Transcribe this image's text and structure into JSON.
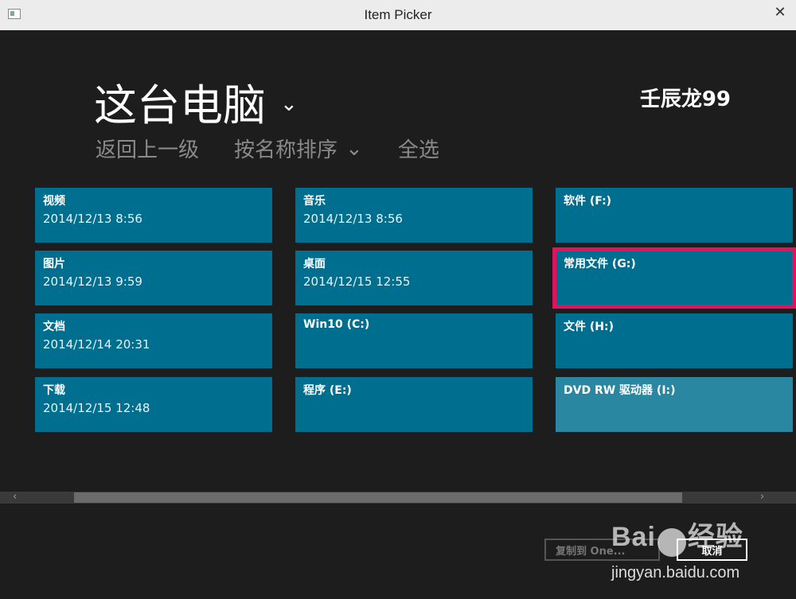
{
  "window": {
    "title": "Item Picker",
    "close": "✕"
  },
  "header": {
    "title": "这台电脑",
    "user": "壬辰龙99"
  },
  "toolbar": {
    "up": "返回上一级",
    "sort": "按名称排序",
    "select_all": "全选"
  },
  "tiles": [
    {
      "name": "视频",
      "date": "2014/12/13 8:56"
    },
    {
      "name": "图片",
      "date": "2014/12/13 9:59"
    },
    {
      "name": "文档",
      "date": "2014/12/14 20:31"
    },
    {
      "name": "下载",
      "date": "2014/12/15 12:48"
    },
    {
      "name": "音乐",
      "date": "2014/12/13 8:56"
    },
    {
      "name": "桌面",
      "date": "2014/12/15 12:55"
    },
    {
      "name": "Win10 (C:)",
      "date": ""
    },
    {
      "name": "程序 (E:)",
      "date": ""
    },
    {
      "name": "软件 (F:)",
      "date": ""
    },
    {
      "name": "常用文件 (G:)",
      "date": ""
    },
    {
      "name": "文件 (H:)",
      "date": ""
    },
    {
      "name": "DVD RW 驱动器 (I:)",
      "date": ""
    }
  ],
  "footer": {
    "copy": "复制到 One...",
    "cancel": "取消"
  },
  "watermark": {
    "brand_left": "Bai",
    "brand_right": "经验",
    "site": "jingyan.baidu.com"
  },
  "colors": {
    "tile": "#006f8f",
    "tile_disabled": "#2a87a1",
    "selection": "#e0145e"
  }
}
